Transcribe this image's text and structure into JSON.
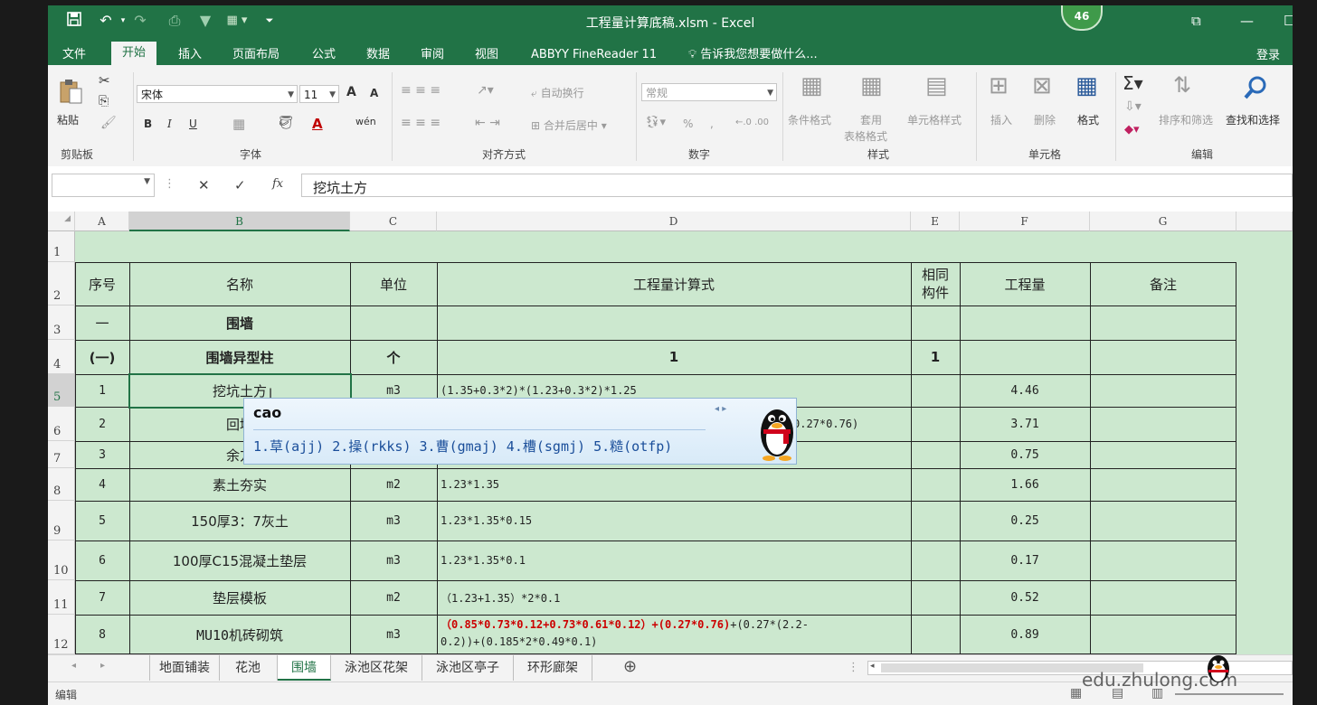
{
  "window": {
    "title": "工程量计算底稿.xlsm - Excel",
    "badge": "46",
    "controls": {
      "restore": "⧉",
      "minimize": "—",
      "maximize": "☐"
    }
  },
  "tabs": [
    "文件",
    "开始",
    "插入",
    "页面布局",
    "公式",
    "数据",
    "审阅",
    "视图",
    "ABBYY FineReader 11"
  ],
  "active_tab": "开始",
  "tell_me": "告诉我您想要做什么...",
  "login": "登录",
  "ribbon": {
    "clipboard": {
      "paste": "粘贴",
      "label": "剪贴板"
    },
    "font": {
      "name": "宋体",
      "size": "11",
      "label": "字体",
      "grow": "A",
      "shrink": "A",
      "bold": "B",
      "italic": "I",
      "underline": "U"
    },
    "alignment": {
      "wrap": "自动换行",
      "merge": "合并后居中",
      "label": "对齐方式"
    },
    "number": {
      "format": "常规",
      "label": "数字",
      "percent": "%",
      "comma": ","
    },
    "styles": {
      "conditional": "条件格式",
      "table_l1": "套用",
      "table_l2": "表格格式",
      "cell": "单元格样式",
      "label": "样式"
    },
    "cells": {
      "insert": "插入",
      "delete": "删除",
      "format": "格式",
      "label": "单元格"
    },
    "editing": {
      "sort": "排序和筛选",
      "find": "查找和选择",
      "label": "编辑"
    }
  },
  "formula_bar": {
    "name_box": "",
    "cancel": "✕",
    "enter": "✓",
    "fx": "fx",
    "content": "挖坑土方"
  },
  "columns": [
    "A",
    "B",
    "C",
    "D",
    "E",
    "F",
    "G"
  ],
  "rows": [
    {
      "num": "1",
      "cells": [
        "",
        "",
        "",
        "",
        "",
        "",
        ""
      ]
    },
    {
      "num": "2",
      "cells": [
        "序号",
        "名称",
        "单位",
        "工程量计算式",
        "相同构件",
        "工程量",
        "备注"
      ]
    },
    {
      "num": "3",
      "cells": [
        "一",
        "围墙",
        "",
        "",
        "",
        "",
        ""
      ]
    },
    {
      "num": "4",
      "cells": [
        "(一)",
        "围墙异型柱",
        "个",
        "1",
        "1",
        "",
        ""
      ]
    },
    {
      "num": "5",
      "cells": [
        "1",
        "挖坑土方",
        "m3",
        "(1.35+0.3*2)*(1.23+0.3*2)*1.25",
        "",
        "4.46",
        ""
      ]
    },
    {
      "num": "6",
      "cells": [
        "2",
        "回填",
        "",
        "0.27*0.76)",
        "",
        "3.71",
        ""
      ]
    },
    {
      "num": "7",
      "cells": [
        "3",
        "余方",
        "",
        "",
        "",
        "0.75",
        ""
      ]
    },
    {
      "num": "8",
      "cells": [
        "4",
        "素土夯实",
        "m2",
        "1.23*1.35",
        "",
        "1.66",
        ""
      ]
    },
    {
      "num": "9",
      "cells": [
        "5",
        "150厚3：7灰土",
        "m3",
        "1.23*1.35*0.15",
        "",
        "0.25",
        ""
      ]
    },
    {
      "num": "10",
      "cells": [
        "6",
        "100厚C15混凝土垫层",
        "m3",
        "1.23*1.35*0.1",
        "",
        "0.17",
        ""
      ]
    },
    {
      "num": "11",
      "cells": [
        "7",
        "垫层模板",
        "m2",
        "（1.23+1.35）*2*0.1",
        "",
        "0.52",
        ""
      ]
    },
    {
      "num": "12",
      "cells": [
        "8",
        "MU10机砖砌筑",
        "m3",
        "",
        "",
        "0.89",
        ""
      ]
    }
  ],
  "row12_formula": {
    "red1": "（0.85*0.73*0.12+0.73*0.61*0.12）+",
    "red2": "(0.27*0.76)",
    "black1": "+(0.27*(2.2-",
    "line2": "0.2))+(0.185*2*0.49*0.1)",
    "red_color": "#cc0000"
  },
  "ime": {
    "input": "cao",
    "candidates": "1.草(ajj) 2.操(rkks) 3.曹(gmaj) 4.槽(sgmj) 5.糙(otfp)"
  },
  "sheets": [
    "地面铺装",
    "花池",
    "围墙",
    "泳池区花架",
    "泳池区亭子",
    "环形廊架"
  ],
  "active_sheet": "围墙",
  "status": {
    "mode": "编辑",
    "watermark": "edu.zhulong.com"
  },
  "colors": {
    "excel_green": "#217346",
    "cell_fill": "#cce8cf"
  }
}
